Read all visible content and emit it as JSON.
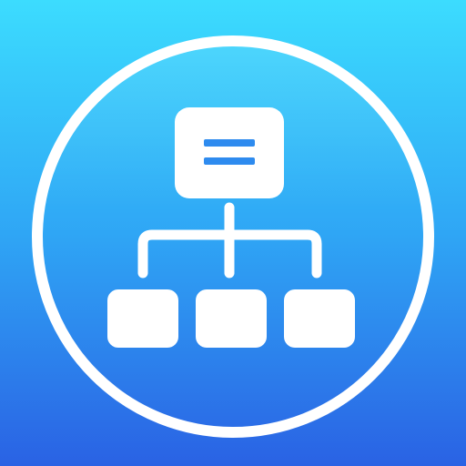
{
  "icon": {
    "name": "org-chart-hierarchy-icon",
    "colors": {
      "gradient_top": "#3CDCFE",
      "gradient_mid": "#2FA6F5",
      "gradient_bottom": "#2A62E4",
      "gloss": "#FFFFFF",
      "foreground": "#FFFFFF",
      "bar": "#2E8BEF"
    }
  }
}
